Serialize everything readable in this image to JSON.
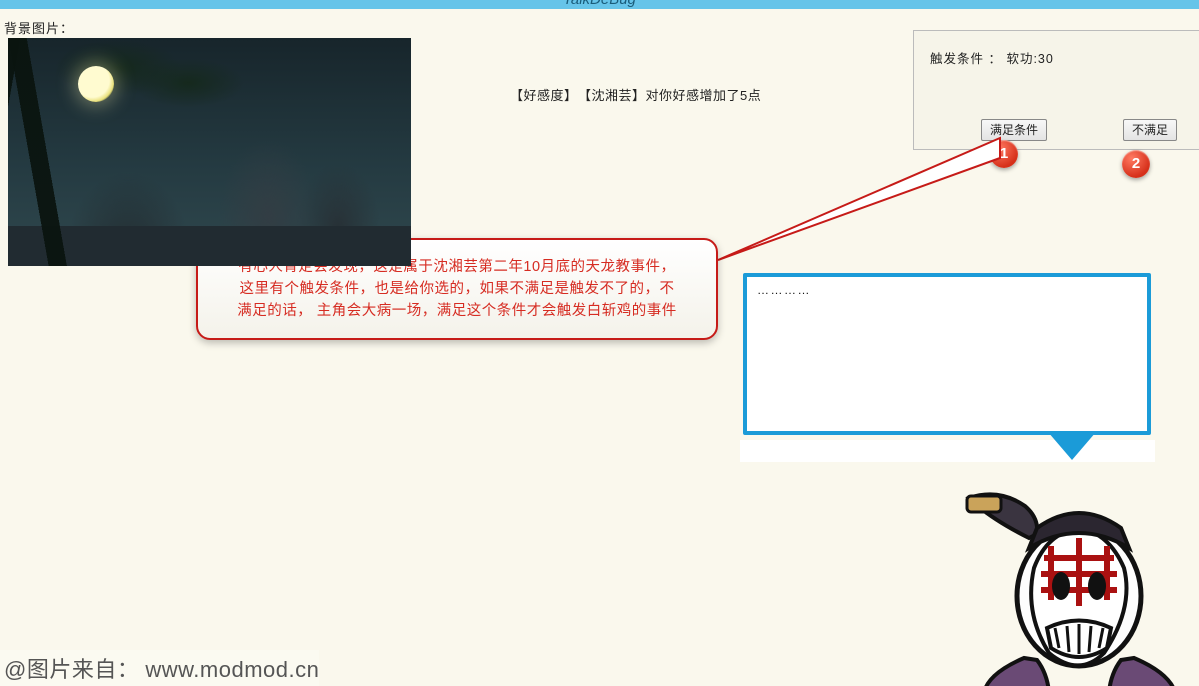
{
  "titlebar": "TalkDeBug",
  "bg_label": "背景图片：",
  "notice": "【好感度】　【沈湘芸】对你好感增加了5点",
  "condition_panel": {
    "label": "触发条件 ： 软功:30",
    "satisfy_btn": "满足条件",
    "unsatisfy_btn": "不满足"
  },
  "badges": {
    "one": "1",
    "two": "2"
  },
  "callout": {
    "line1": "有心人肯定会发现，这是属于沈湘芸第二年10月底的天龙教事件，",
    "line2": "这里有个触发条件，也是给你选的，如果不满足是触发不了的，不",
    "line3": "满足的话，  主角会大病一场，满足这个条件才会触发白斩鸡的事件"
  },
  "dialog": {
    "text": "…………"
  },
  "watermark": {
    "prefix": "@图片来自：",
    "url": "www.modmod.cn"
  }
}
